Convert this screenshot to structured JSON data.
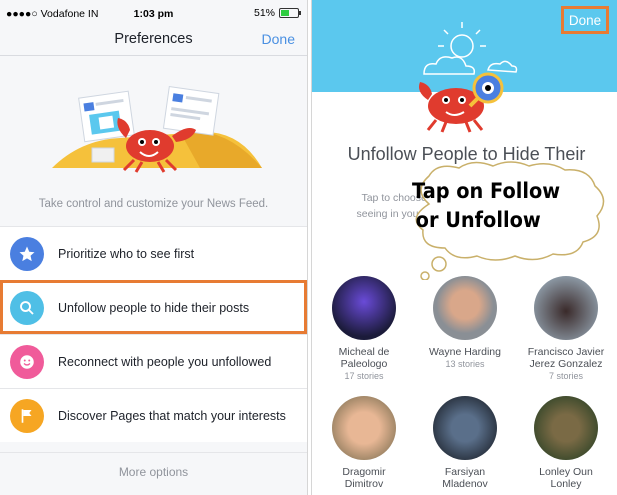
{
  "left": {
    "status_bar": {
      "carrier": "●●●●○ Vodafone IN",
      "time": "1:03 pm",
      "battery": "51%"
    },
    "nav": {
      "title": "Preferences",
      "done": "Done"
    },
    "subtitle": "Take control and customize your News Feed.",
    "items": [
      {
        "label": "Prioritize who to see first",
        "icon": "star-icon",
        "color": "#4a7fe0"
      },
      {
        "label": "Unfollow people to hide their posts",
        "icon": "search-icon",
        "color": "#4fbfe6"
      },
      {
        "label": "Reconnect with people you unfollowed",
        "icon": "smiley-icon",
        "color": "#f05b9a"
      },
      {
        "label": "Discover Pages that match your interests",
        "icon": "flag-icon",
        "color": "#f6a623"
      }
    ],
    "more_options": "More options"
  },
  "right": {
    "done": "Done",
    "heading": "Unfollow People to Hide Their Posts",
    "description_line1": "Tap to choose whose posts you want to stop",
    "description_line2": "seeing in your News Feed. Only you will know.",
    "callout_line1": "Tap on Follow",
    "callout_line2": "or Unfollow",
    "people": [
      {
        "name_line1": "Micheal de",
        "name_line2": "Paleologo",
        "stories": "17 stories"
      },
      {
        "name_line1": "Wayne Harding",
        "name_line2": "",
        "stories": "13 stories"
      },
      {
        "name_line1": "Francisco Javier",
        "name_line2": "Jerez Gonzalez",
        "stories": "7 stories"
      },
      {
        "name_line1": "Dragomir",
        "name_line2": "Dimitrov",
        "stories": ""
      },
      {
        "name_line1": "Farsiyan",
        "name_line2": "Mladenov",
        "stories": ""
      },
      {
        "name_line1": "Lonley Oun",
        "name_line2": "Lonley",
        "stories": ""
      }
    ]
  },
  "colors": {
    "accent": "#4a90e2",
    "highlight": "#e77b33",
    "header_blue": "#5bc8ee"
  }
}
